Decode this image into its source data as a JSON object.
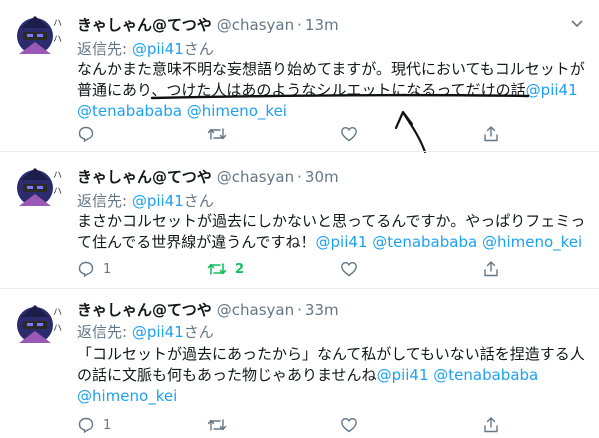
{
  "accent": "#1da1f2",
  "retweet_color": "#17bf63",
  "muted": "#657786",
  "tweets": [
    {
      "name": "きゃしゃん@てつや",
      "handle": "@chasyan",
      "dot": "·",
      "time": "13m",
      "reply_prefix": "返信先: ",
      "reply_to": "@pii41",
      "reply_suffix": "さん",
      "line1": "なんかまた意味不明な妄想語り始めてますが。現代においてもコルセットが",
      "line2_a": "普通にあり、",
      "line2_b": "つけた人はあのようなシルエットになるってだけの話",
      "line2_mention": "@pii41",
      "line3_mentions": "@tenabababa @himeno_kei",
      "reply_count": "",
      "retweet_count": "",
      "like_count": ""
    },
    {
      "name": "きゃしゃん@てつや",
      "handle": "@chasyan",
      "dot": "·",
      "time": "30m",
      "reply_prefix": "返信先: ",
      "reply_to": "@pii41",
      "reply_suffix": "さん",
      "line1": "まさかコルセットが過去にしかないと思ってるんですか。やっぱりフェミっ",
      "line2_text": "て住んでる世界線が違うんですね！",
      "line2_mentions": "@pii41 @tenabababa @himeno_kei",
      "reply_count": "1",
      "retweet_count": "2",
      "like_count": ""
    },
    {
      "name": "きゃしゃん@てつや",
      "handle": "@chasyan",
      "dot": "·",
      "time": "33m",
      "reply_prefix": "返信先: ",
      "reply_to": "@pii41",
      "reply_suffix": "さん",
      "line1": "「コルセットが過去にあったから」なんて私がしてもいない話を捏造する人",
      "line2_text": "の話に文脈も何もあった物じゃありませんね",
      "line2_mentions": "@pii41 @tenabababa",
      "line3_mentions": "@himeno_kei",
      "reply_count": "1",
      "retweet_count": "",
      "like_count": ""
    }
  ]
}
